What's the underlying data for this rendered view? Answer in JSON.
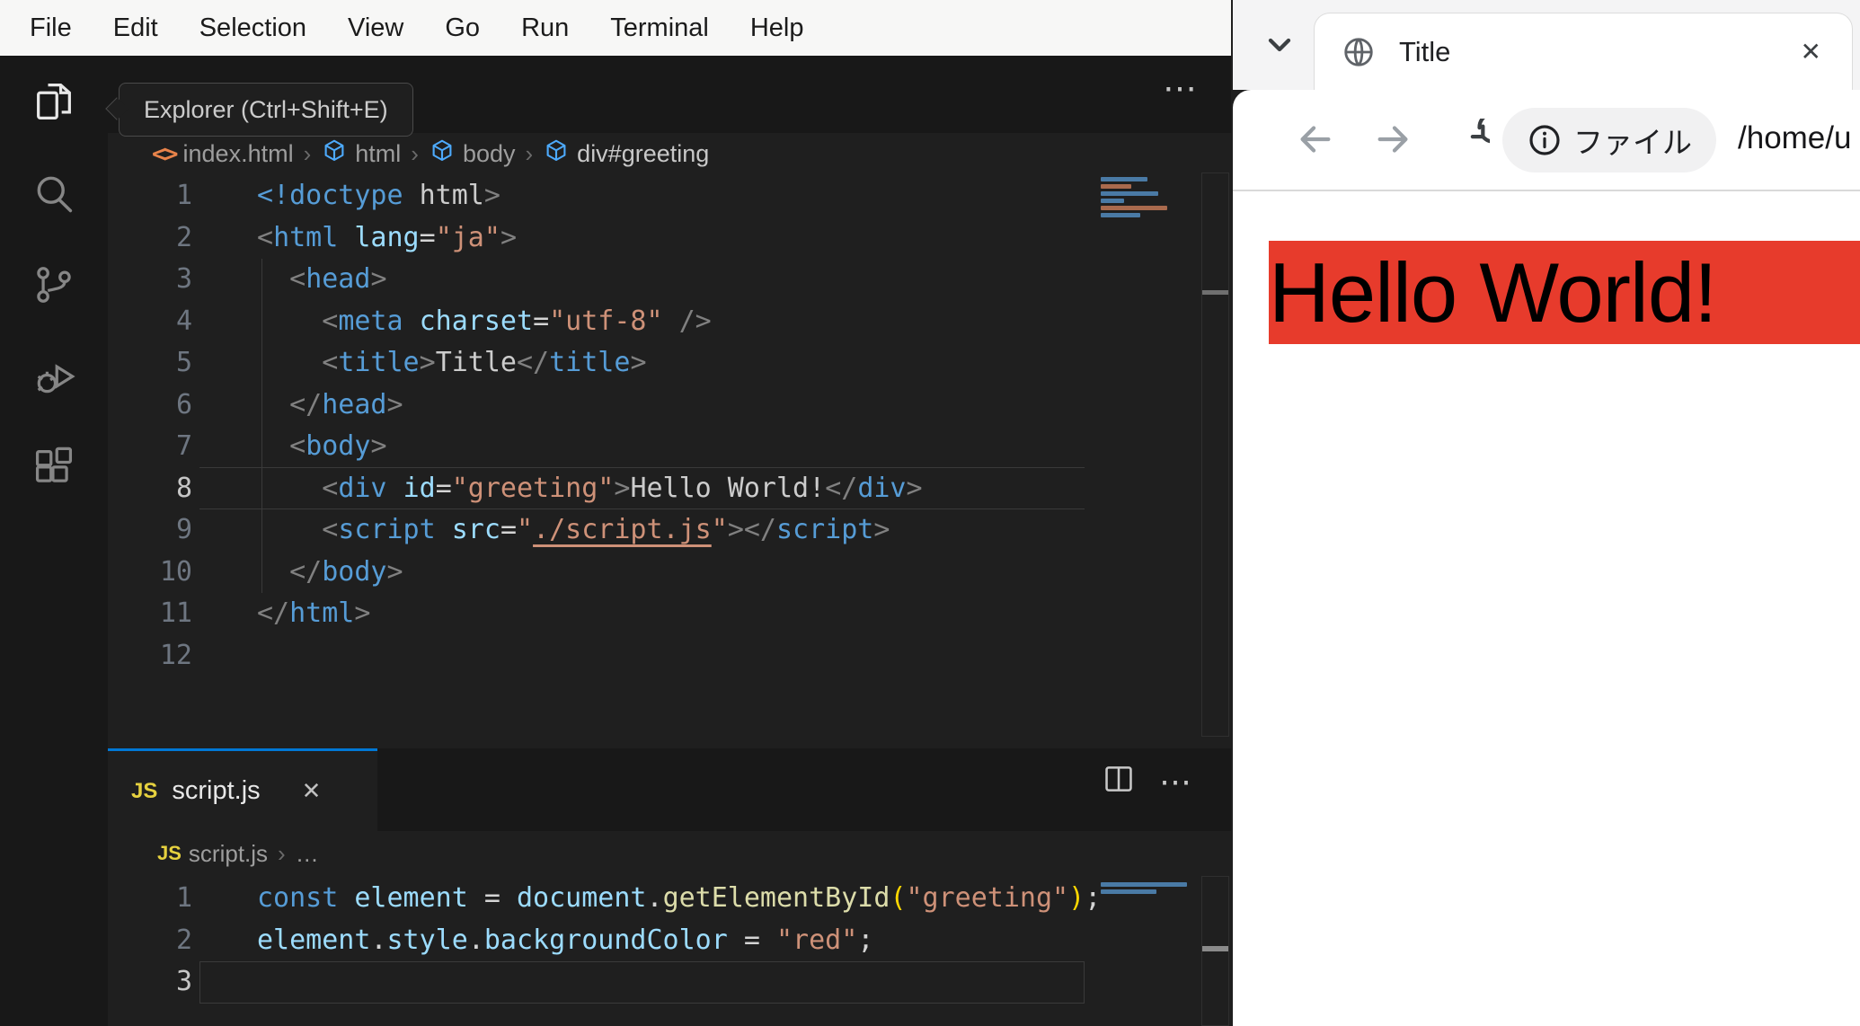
{
  "colors": {
    "accent_blue": "#0078d4",
    "editor_bg": "#1f1f1f",
    "chrome_dark": "#181818",
    "menu_bg": "#f7f7f6",
    "js_yellow": "#e6d13f",
    "red_div_bg": "#e73b2c",
    "mm_blue": "#4a7aa5",
    "mm_orange": "#a96a4d"
  },
  "vscode": {
    "menu": {
      "items": [
        "File",
        "Edit",
        "Selection",
        "View",
        "Go",
        "Run",
        "Terminal",
        "Help"
      ]
    },
    "activity_bar": {
      "items": [
        {
          "icon": "explorer-icon",
          "label": "explorer",
          "active": true
        },
        {
          "icon": "search-icon",
          "label": "search",
          "active": false
        },
        {
          "icon": "source-control-icon",
          "label": "source-control",
          "active": false
        },
        {
          "icon": "run-debug-icon",
          "label": "run-and-debug",
          "active": false
        },
        {
          "icon": "extensions-icon",
          "label": "extensions",
          "active": false
        }
      ]
    },
    "tooltip": "Explorer (Ctrl+Shift+E)",
    "editor_actions_icon": "more-actions-icon",
    "editor_actions_glyph": "⋯",
    "breadcrumb": {
      "segments": [
        {
          "icon": "code-tag-icon",
          "label": "index.html"
        },
        {
          "icon": "symbol-cube-icon",
          "label": "html"
        },
        {
          "icon": "symbol-cube-icon",
          "label": "body"
        },
        {
          "icon": "symbol-cube-icon",
          "label": "div#greeting",
          "last": true
        }
      ]
    },
    "html_editor": {
      "lines": [
        {
          "n": "1",
          "t": [
            [
              "tag",
              "<!doctype"
            ],
            [
              "text",
              " html"
            ],
            [
              "punct",
              ">"
            ]
          ]
        },
        {
          "n": "2",
          "t": [
            [
              "punct",
              "<"
            ],
            [
              "tag",
              "html"
            ],
            [
              "text",
              " "
            ],
            [
              "attr",
              "lang"
            ],
            [
              "op",
              "="
            ],
            [
              "str",
              "\"ja\""
            ],
            [
              "punct",
              ">"
            ]
          ]
        },
        {
          "n": "3",
          "t": [
            [
              "text",
              "  "
            ],
            [
              "punct",
              "<"
            ],
            [
              "tag",
              "head"
            ],
            [
              "punct",
              ">"
            ]
          ]
        },
        {
          "n": "4",
          "t": [
            [
              "text",
              "    "
            ],
            [
              "punct",
              "<"
            ],
            [
              "tag",
              "meta"
            ],
            [
              "text",
              " "
            ],
            [
              "attr",
              "charset"
            ],
            [
              "op",
              "="
            ],
            [
              "str",
              "\"utf-8\""
            ],
            [
              "text",
              " "
            ],
            [
              "punct",
              "/>"
            ]
          ]
        },
        {
          "n": "5",
          "t": [
            [
              "text",
              "    "
            ],
            [
              "punct",
              "<"
            ],
            [
              "tag",
              "title"
            ],
            [
              "punct",
              ">"
            ],
            [
              "text",
              "Title"
            ],
            [
              "punct",
              "</"
            ],
            [
              "tag",
              "title"
            ],
            [
              "punct",
              ">"
            ]
          ]
        },
        {
          "n": "6",
          "t": [
            [
              "text",
              "  "
            ],
            [
              "punct",
              "</"
            ],
            [
              "tag",
              "head"
            ],
            [
              "punct",
              ">"
            ]
          ]
        },
        {
          "n": "7",
          "t": [
            [
              "text",
              "  "
            ],
            [
              "punct",
              "<"
            ],
            [
              "tag",
              "body"
            ],
            [
              "punct",
              ">"
            ]
          ]
        },
        {
          "n": "8",
          "cur": true,
          "t": [
            [
              "text",
              "    "
            ],
            [
              "punct",
              "<"
            ],
            [
              "tag",
              "div"
            ],
            [
              "text",
              " "
            ],
            [
              "attr",
              "id"
            ],
            [
              "op",
              "="
            ],
            [
              "str",
              "\"greeting\""
            ],
            [
              "punct",
              ">"
            ],
            [
              "text",
              "Hello World!"
            ],
            [
              "punct",
              "</"
            ],
            [
              "tag",
              "div"
            ],
            [
              "punct",
              ">"
            ]
          ]
        },
        {
          "n": "9",
          "t": [
            [
              "text",
              "    "
            ],
            [
              "punct",
              "<"
            ],
            [
              "tag",
              "script"
            ],
            [
              "text",
              " "
            ],
            [
              "attr",
              "src"
            ],
            [
              "op",
              "="
            ],
            [
              "str",
              "\""
            ],
            [
              "link",
              "./script.js"
            ],
            [
              "str",
              "\""
            ],
            [
              "punct",
              ">"
            ],
            [
              "punct",
              "</"
            ],
            [
              "tag",
              "script"
            ],
            [
              "punct",
              ">"
            ]
          ]
        },
        {
          "n": "10",
          "t": [
            [
              "text",
              "  "
            ],
            [
              "punct",
              "</"
            ],
            [
              "tag",
              "body"
            ],
            [
              "punct",
              ">"
            ]
          ]
        },
        {
          "n": "11",
          "t": [
            [
              "punct",
              "</"
            ],
            [
              "tag",
              "html"
            ],
            [
              "punct",
              ">"
            ]
          ]
        },
        {
          "n": "12",
          "t": []
        }
      ]
    },
    "panel": {
      "tab": {
        "icon_label": "JS",
        "label": "script.js",
        "close_glyph": "✕"
      },
      "actions": {
        "split_icon": "split-editor-icon",
        "more_glyph": "⋯"
      },
      "breadcrumb": {
        "segments": [
          {
            "icon": "js-icon",
            "label": "script.js"
          },
          {
            "label": "…"
          }
        ]
      },
      "js_editor": {
        "lines": [
          {
            "n": "1",
            "t": [
              [
                "kw",
                "const"
              ],
              [
                "text",
                " "
              ],
              [
                "var",
                "element"
              ],
              [
                "text",
                " "
              ],
              [
                "op",
                "="
              ],
              [
                "text",
                " "
              ],
              [
                "var",
                "document"
              ],
              [
                "op",
                "."
              ],
              [
                "fn",
                "getElementById"
              ],
              [
                "brkt",
                "("
              ],
              [
                "str",
                "\"greeting\""
              ],
              [
                "brkt",
                ")"
              ],
              [
                "op",
                ";"
              ]
            ]
          },
          {
            "n": "2",
            "t": [
              [
                "var",
                "element"
              ],
              [
                "op",
                "."
              ],
              [
                "var",
                "style"
              ],
              [
                "op",
                "."
              ],
              [
                "var",
                "backgroundColor"
              ],
              [
                "text",
                " "
              ],
              [
                "op",
                "="
              ],
              [
                "text",
                " "
              ],
              [
                "str",
                "\"red\""
              ],
              [
                "op",
                ";"
              ]
            ]
          },
          {
            "n": "3",
            "cur": true,
            "t": []
          }
        ]
      }
    }
  },
  "browser": {
    "tab": {
      "title": "Title",
      "close_glyph": "✕",
      "favicon": "globe-icon"
    },
    "tab_search_icon": "chevron-down-icon",
    "toolbar": {
      "back_icon": "back-arrow-icon",
      "forward_icon": "forward-arrow-icon",
      "reload_icon": "reload-icon",
      "chip_icon": "info-icon",
      "chip_label": "ファイル",
      "url": "/home/u"
    },
    "page": {
      "greeting_text": "Hello World!"
    }
  }
}
